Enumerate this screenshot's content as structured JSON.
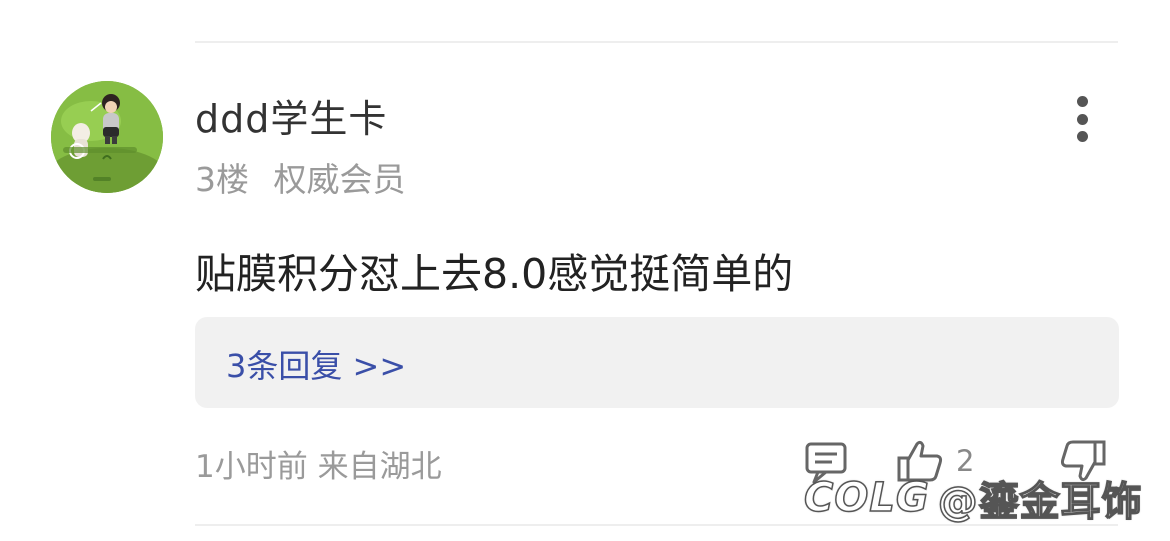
{
  "post": {
    "username": "ddd学生卡",
    "floor": "3楼",
    "badge": "权威会员",
    "content": "贴膜积分怼上去8.0感觉挺简单的",
    "replies_link": "3条回复 >>",
    "time_location": "1小时前 来自湖北",
    "like_count": "2"
  },
  "watermark": {
    "brand": "COLG",
    "author": "@鎏金耳饰"
  },
  "icons": {
    "more": "more-vertical-icon",
    "reply": "comment-icon",
    "like": "thumbs-up-icon",
    "dislike": "thumbs-down-icon"
  },
  "colors": {
    "link": "#3a4fa8",
    "meta": "#9a9a9a",
    "reply_box_bg": "#f1f1f1"
  }
}
